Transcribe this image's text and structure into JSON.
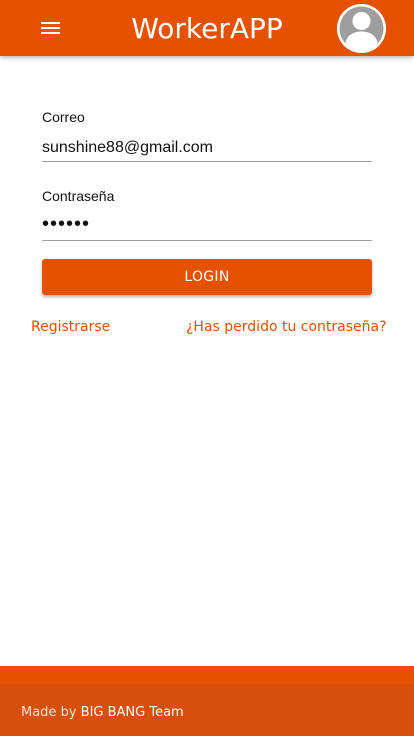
{
  "header": {
    "title": "WorkerAPP",
    "menu_icon": "hamburger-menu-icon",
    "avatar_icon": "user-avatar-icon"
  },
  "form": {
    "email_label": "Correo",
    "email_value": "sunshine88@gmail.com",
    "password_label": "Contraseña",
    "password_value": "••••••",
    "login_label": "LOGIN"
  },
  "links": {
    "register": "Registrarse",
    "forgot_password": "¿Has perdido tu contraseña?"
  },
  "footer": {
    "made_by": "Made by",
    "team": "BIG BANG Team"
  },
  "colors": {
    "accent": "#e65100",
    "footer_dark": "#d84f0b"
  }
}
